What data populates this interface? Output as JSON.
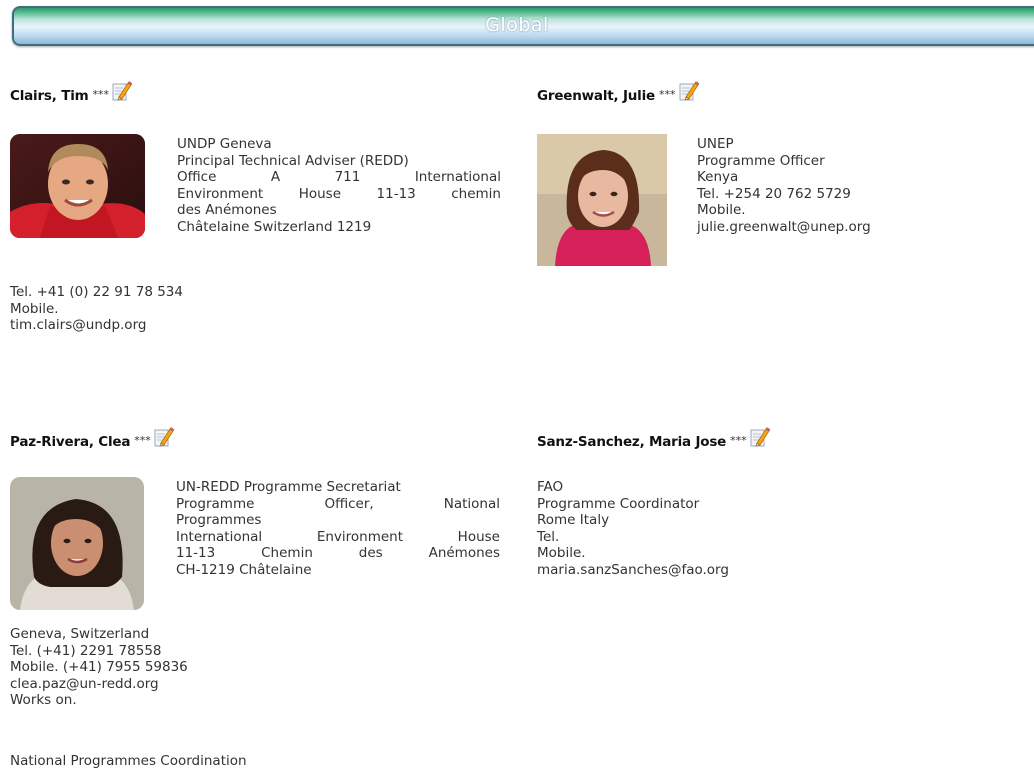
{
  "header": {
    "title": "Global"
  },
  "contacts": [
    {
      "name": "Clairs, Tim",
      "stars": "***",
      "org": "UNDP Geneva",
      "title_lines": [
        "Principal Technical Adviser (REDD)"
      ],
      "address_lines": [
        "Office A 711 International",
        "Environment House 11-13 chemin",
        "des Anémones",
        "Châtelaine Switzerland 1219"
      ],
      "tel": "Tel. +41 (0) 22 91 78 534",
      "mobile": "Mobile.",
      "email": "tim.clairs@undp.org"
    },
    {
      "name": "Greenwalt, Julie",
      "stars": "***",
      "org": "UNEP",
      "title_lines": [
        "Programme Officer"
      ],
      "address_lines": [
        "Kenya"
      ],
      "tel": "Tel. +254 20 762 5729",
      "mobile": "Mobile.",
      "email": "julie.greenwalt@unep.org"
    },
    {
      "name": "Paz-Rivera, Clea",
      "stars": "***",
      "org": "UN-REDD Programme Secretariat",
      "title_lines": [
        "Programme Officer, National",
        "Programmes"
      ],
      "address_lines": [
        "International Environment House",
        "11-13 Chemin des Anémones",
        "CH-1219 Châtelaine",
        "Geneva, Switzerland"
      ],
      "tel": "Tel. (+41) 2291 78558",
      "mobile": "Mobile. (+41) 7955 59836",
      "email": "clea.paz@un-redd.org",
      "works_on_label": "Works on.",
      "works_on": [
        "National Programmes Coordination"
      ]
    },
    {
      "name": "Sanz-Sanchez, Maria Jose",
      "stars": "***",
      "org": "FAO",
      "title_lines": [
        "Programme Coordinator"
      ],
      "address_lines": [
        "Rome Italy"
      ],
      "tel": "Tel.",
      "mobile": "Mobile.",
      "email": "maria.sanzSanches@fao.org"
    }
  ],
  "icons": {
    "edit": "edit-pencil-icon"
  },
  "colors": {
    "header_border": "#3f6f7f",
    "header_green": "#2e9a6e",
    "header_blue": "#8db6dc",
    "text": "#333333"
  }
}
